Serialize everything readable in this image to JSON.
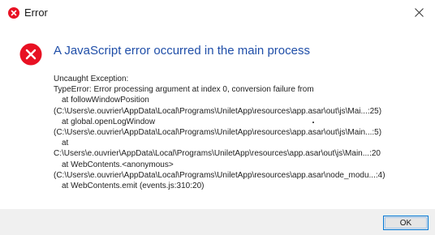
{
  "window": {
    "title": "Error",
    "close_symbol": "×"
  },
  "header": {
    "text": "A JavaScript error occurred in the main process"
  },
  "message": {
    "lines": [
      {
        "text": "Uncaught Exception:",
        "indent": false
      },
      {
        "text": "TypeError: Error processing argument at index 0, conversion failure from",
        "indent": false
      },
      {
        "text": "at followWindowPosition",
        "indent": true
      },
      {
        "text": "(C:\\Users\\e.ouvrier\\AppData\\Local\\Programs\\UniletApp\\resources\\app.asar\\out\\js\\Mai...:25)",
        "indent": false
      },
      {
        "text": "at global.openLogWindow",
        "indent": true
      },
      {
        "text": "(C:\\Users\\e.ouvrier\\AppData\\Local\\Programs\\UniletApp\\resources\\app.asar\\out\\js\\Main...:5)",
        "indent": false
      },
      {
        "text": "at",
        "indent": true
      },
      {
        "text": "C:\\Users\\e.ouvrier\\AppData\\Local\\Programs\\UniletApp\\resources\\app.asar\\out\\js\\Main...:20",
        "indent": false
      },
      {
        "text": "at WebContents.<anonymous>",
        "indent": true
      },
      {
        "text": "(C:\\Users\\e.ouvrier\\AppData\\Local\\Programs\\UniletApp\\resources\\app.asar\\node_modu...:4)",
        "indent": false
      },
      {
        "text": "at WebContents.emit (events.js:310:20)",
        "indent": true
      }
    ]
  },
  "footer": {
    "ok_label": "OK"
  },
  "colors": {
    "error_red": "#e81123",
    "header_blue": "#1f4ea8",
    "button_border": "#0078d7"
  },
  "icons": {
    "title": "error-icon",
    "header": "error-icon",
    "close": "close-icon"
  }
}
